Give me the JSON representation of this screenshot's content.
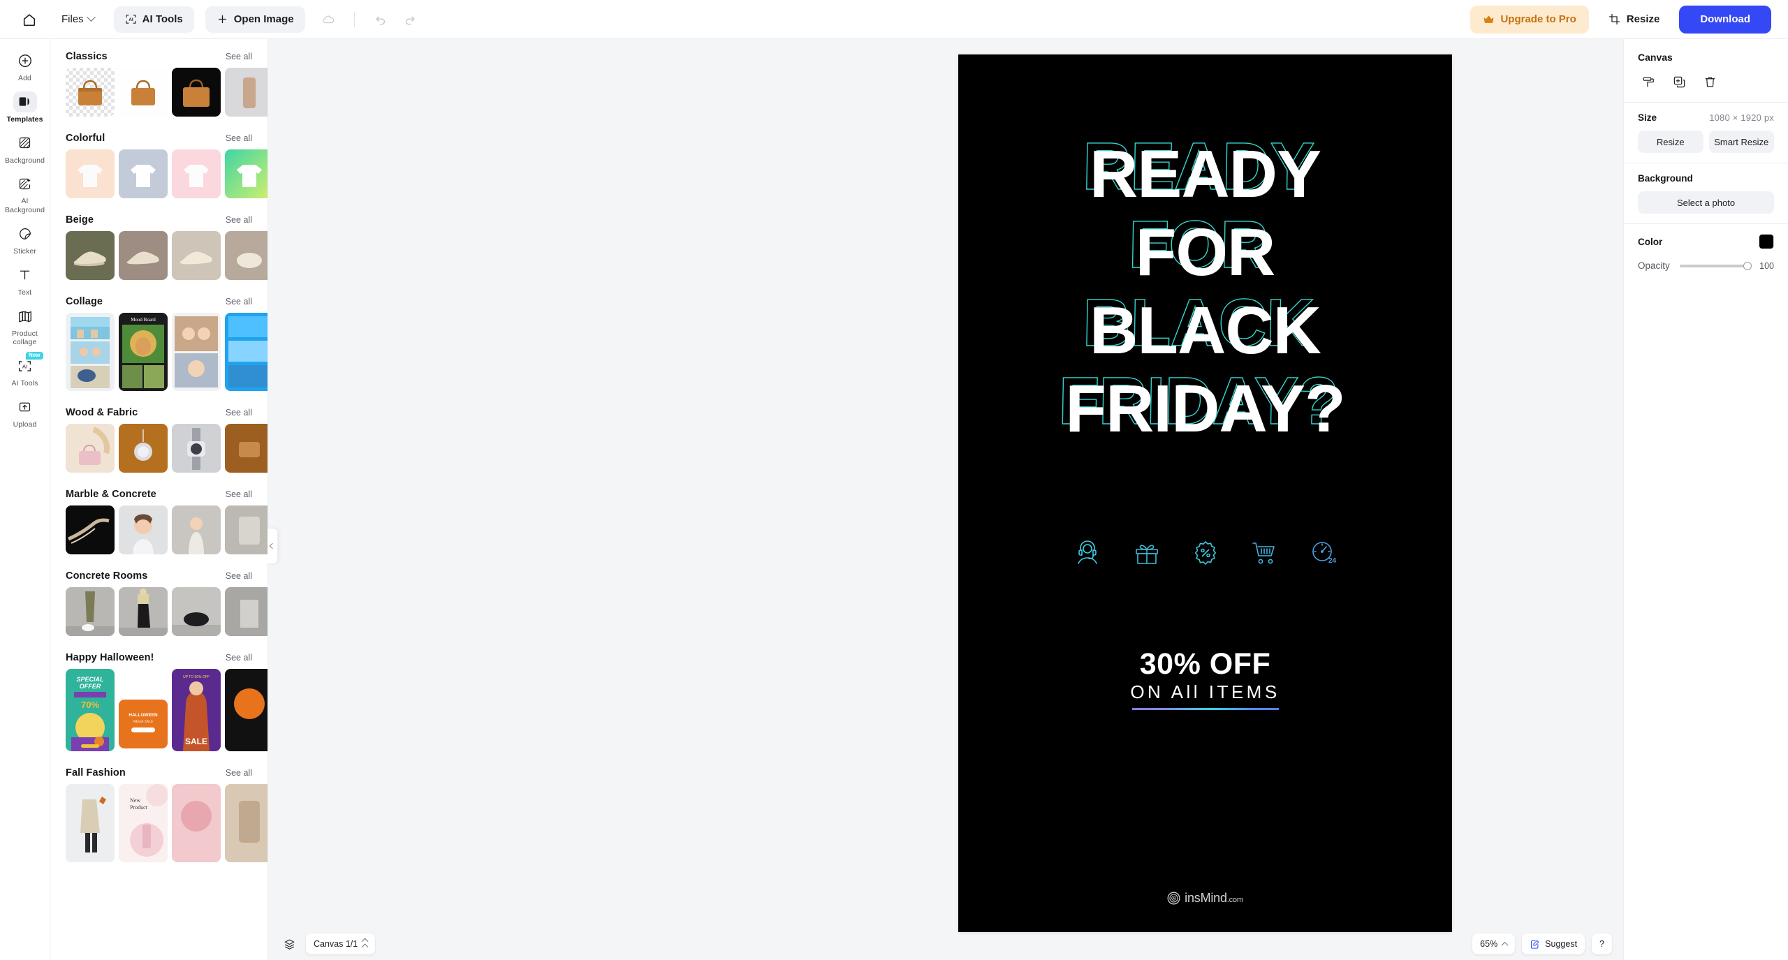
{
  "topbar": {
    "home_icon": "home-icon",
    "files_label": "Files",
    "ai_tools_label": "AI Tools",
    "open_image_label": "Open Image",
    "cloud_icon": "cloud-sync-icon",
    "undo_icon": "undo-icon",
    "redo_icon": "redo-icon",
    "upgrade_label": "Upgrade to Pro",
    "crown_icon": "crown-icon",
    "resize_label": "Resize",
    "crop_icon": "crop-icon",
    "download_label": "Download"
  },
  "rail": {
    "items": [
      {
        "label": "Add",
        "icon": "plus-circle-icon",
        "active": false,
        "badge": ""
      },
      {
        "label": "Templates",
        "icon": "templates-icon",
        "active": true,
        "badge": ""
      },
      {
        "label": "Background",
        "icon": "background-icon",
        "active": false,
        "badge": ""
      },
      {
        "label": "AI Background",
        "icon": "ai-background-icon",
        "active": false,
        "badge": ""
      },
      {
        "label": "Sticker",
        "icon": "sticker-icon",
        "active": false,
        "badge": ""
      },
      {
        "label": "Text",
        "icon": "text-icon",
        "active": false,
        "badge": ""
      },
      {
        "label": "Product collage",
        "icon": "product-collage-icon",
        "active": false,
        "badge": ""
      },
      {
        "label": "AI Tools",
        "icon": "ai-tools-icon",
        "active": false,
        "badge": "New"
      },
      {
        "label": "Upload",
        "icon": "upload-icon",
        "active": false,
        "badge": ""
      }
    ]
  },
  "templates": {
    "see_all_label": "See all",
    "groups": [
      {
        "title": "Classics",
        "kind": "bag"
      },
      {
        "title": "Colorful",
        "kind": "tshirt"
      },
      {
        "title": "Beige",
        "kind": "sneaker"
      },
      {
        "title": "Collage",
        "kind": "collage"
      },
      {
        "title": "Wood & Fabric",
        "kind": "wood"
      },
      {
        "title": "Marble & Concrete",
        "kind": "marble"
      },
      {
        "title": "Concrete Rooms",
        "kind": "concrete"
      },
      {
        "title": "Happy Halloween!",
        "kind": "halloween"
      },
      {
        "title": "Fall Fashion",
        "kind": "fall"
      }
    ]
  },
  "canvas": {
    "headline_lines": [
      "READY",
      "FOR",
      "BLACK",
      "FRIDAY?"
    ],
    "feature_icons": [
      "support-headset-icon",
      "gift-icon",
      "percent-badge-icon",
      "shopping-cart-icon",
      "clock-24-icon"
    ],
    "offer_headline": "30% OFF",
    "offer_sub": "ON All ITEMS",
    "watermark_name": "insMind",
    "watermark_tld": ".com",
    "watermark_icon": "insmind-logo-icon",
    "bg_color": "#000000",
    "accent_color": "#35e0d8",
    "underline_gradient": [
      "#8a7ae0",
      "#3ad3e0",
      "#5f7be8"
    ]
  },
  "right_panel": {
    "title": "Canvas",
    "tools": [
      "paint-roller-icon",
      "duplicate-icon",
      "trash-icon"
    ],
    "size_label": "Size",
    "size_value": "1080 × 1920 px",
    "resize_label": "Resize",
    "smart_resize_label": "Smart Resize",
    "background_label": "Background",
    "select_photo_label": "Select a photo",
    "color_label": "Color",
    "color_value": "#000000",
    "opacity_label": "Opacity",
    "opacity_value": "100"
  },
  "bottombar": {
    "layers_icon": "layers-icon",
    "canvas_pages_label": "Canvas 1/1",
    "zoom_label": "65%",
    "suggest_label": "Suggest",
    "suggest_icon": "suggest-note-icon",
    "help_label": "?"
  }
}
